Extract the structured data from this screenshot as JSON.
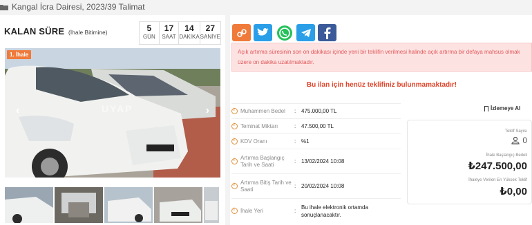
{
  "header": {
    "title": "Kangal İcra Dairesi, 2023/39 Talimat"
  },
  "countdown": {
    "label": "KALAN SÜRE",
    "sublabel": "(İhale Bitimine)",
    "units": [
      {
        "value": "5",
        "label": "GÜN"
      },
      {
        "value": "17",
        "label": "SAAT"
      },
      {
        "value": "14",
        "label": "DAKİKA"
      },
      {
        "value": "27",
        "label": "SANİYE"
      }
    ]
  },
  "gallery": {
    "badge": "1. İhale",
    "watermark": "UYAP"
  },
  "share": [
    "link-icon",
    "twitter-icon",
    "whatsapp-icon",
    "telegram-icon",
    "facebook-icon"
  ],
  "alert": "Açık artırma süresinin son on dakikası içinde yeni bir teklifin verilmesi halinde açık artırma bir defaya mahsus olmak üzere on dakika uzatılmaktadır.",
  "no_bid": "Bu ilan için henüz teklifiniz bulunmamaktadır!",
  "details": [
    {
      "key": "Muhammen Bedel",
      "value": "475.000,00 TL"
    },
    {
      "key": "Teminat Miktarı",
      "value": "47.500,00 TL"
    },
    {
      "key": "KDV Oranı",
      "value": "%1"
    },
    {
      "key": "Artırma Başlangıç Tarih ve Saati",
      "value": "13/02/2024 10:08"
    },
    {
      "key": "Artırma Bitiş Tarih ve Saati",
      "value": "20/02/2024 10:08"
    },
    {
      "key": "İhale Yeri",
      "value": "Bu ihale elektronik ortamda sonuçlanacaktır."
    }
  ],
  "watch_label": "İzlemeye Al",
  "bid_panel": {
    "count_label": "Teklif Sayısı",
    "count_value": "0",
    "start_label": "İhale Başlangıç Bedeli",
    "start_value": "₺247.500,00",
    "highest_label": "İhaleye Verilen En Yüksek Teklif",
    "highest_value": "₺0,00"
  },
  "colors": {
    "alert_bg": "#fde2e2",
    "alert_text": "#e05a5a",
    "accent": "#e0452b",
    "badge": "#f07a3a"
  }
}
